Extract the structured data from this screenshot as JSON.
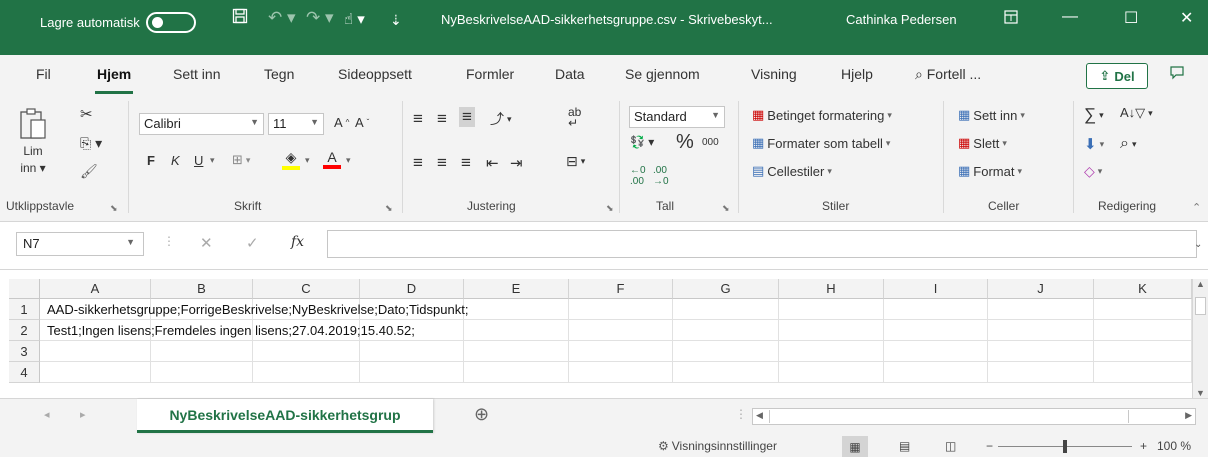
{
  "titlebar": {
    "autosave_label": "Lagre automatisk",
    "autosave_state": "off",
    "document_title": "NyBeskrivelseAAD-sikkerhetsgruppe.csv  -  Skrivebeskyt...",
    "user_name": "Cathinka Pedersen",
    "brand_color": "#217346"
  },
  "tabs": [
    "Fil",
    "Hjem",
    "Sett inn",
    "Tegn",
    "Sideoppsett",
    "Formler",
    "Data",
    "Se gjennom",
    "Visning",
    "Hjelp"
  ],
  "active_tab": "Hjem",
  "tell_me": "Fortell ...",
  "share_label": "Del",
  "ribbon": {
    "clipboard": {
      "paste_label": "Lim",
      "paste_label2": "inn",
      "group": "Utklippstavle"
    },
    "font": {
      "name": "Calibri",
      "size": "11",
      "bold": "F",
      "italic": "K",
      "underline": "U",
      "group": "Skrift"
    },
    "alignment": {
      "group": "Justering"
    },
    "number": {
      "format": "Standard",
      "percent": "%",
      "thousands": "000",
      "group": "Tall"
    },
    "styles": {
      "conditional": "Betinget formatering",
      "as_table": "Formater som tabell",
      "cell_styles": "Cellestiler",
      "group": "Stiler"
    },
    "cells": {
      "insert": "Sett inn",
      "delete": "Slett",
      "format": "Format",
      "group": "Celler"
    },
    "editing": {
      "group": "Redigering"
    }
  },
  "formula_bar": {
    "name_box": "N7",
    "fx": "fx",
    "formula": ""
  },
  "columns": [
    "A",
    "B",
    "C",
    "D",
    "E",
    "F",
    "G",
    "H",
    "I",
    "J",
    "K"
  ],
  "rows": [
    {
      "num": "1",
      "text": "AAD-sikkerhetsgruppe;ForrigeBeskrivelse;NyBeskrivelse;Dato;Tidspunkt;"
    },
    {
      "num": "2",
      "text": "Test1;Ingen lisens;Fremdeles ingen lisens;27.04.2019;15.40.52;"
    },
    {
      "num": "3",
      "text": ""
    },
    {
      "num": "4",
      "text": ""
    }
  ],
  "sheet_tab": "NyBeskrivelseAAD-sikkerhetsgrup",
  "statusbar": {
    "view_settings": "Visningsinnstillinger",
    "zoom": "100 %",
    "zoom_fraction": 0.5
  }
}
